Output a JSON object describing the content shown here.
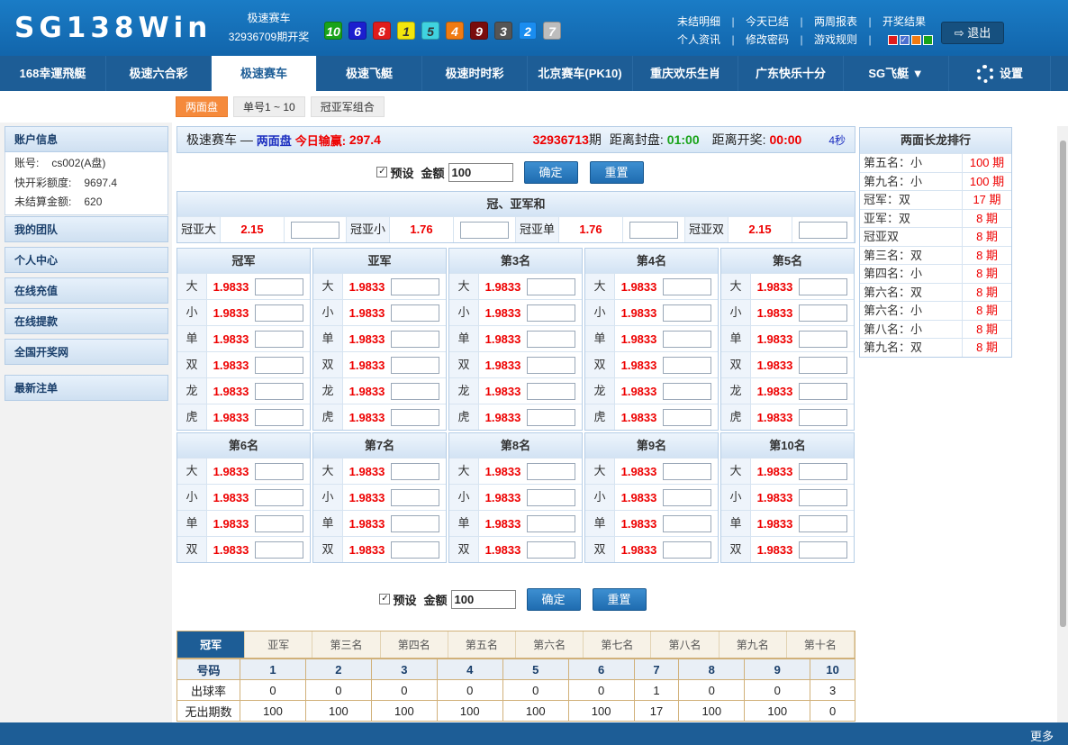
{
  "brand": {
    "logo": "SG138Win",
    "game": "极速赛车",
    "period": "32936709期开奖"
  },
  "balls": [
    {
      "n": "10",
      "c": "#19a319"
    },
    {
      "n": "6",
      "c": "#1b1fcf"
    },
    {
      "n": "8",
      "c": "#e01c1c"
    },
    {
      "n": "1",
      "c": "#f2e60d"
    },
    {
      "n": "5",
      "c": "#3fd3e0"
    },
    {
      "n": "4",
      "c": "#f07b12"
    },
    {
      "n": "9",
      "c": "#7a0c0c"
    },
    {
      "n": "3",
      "c": "#555555"
    },
    {
      "n": "2",
      "c": "#1a8df0"
    },
    {
      "n": "7",
      "c": "#bdbdbd"
    }
  ],
  "links": {
    "r1": [
      "未结明细",
      "今天已结",
      "两周报表",
      "开奖结果"
    ],
    "r2": [
      "个人资讯",
      "修改密码",
      "游戏规则"
    ]
  },
  "skins": [
    "#e01c1c",
    "#4a6fd0",
    "#f07b12",
    "#19a319"
  ],
  "logout": "退出",
  "nav": [
    {
      "l": "168幸運飛艇",
      "w": 118
    },
    {
      "l": "极速六合彩",
      "w": 117
    },
    {
      "l": "极速赛车",
      "w": 117,
      "a": true
    },
    {
      "l": "极速飞艇",
      "w": 117
    },
    {
      "l": "极速时时彩",
      "w": 117
    },
    {
      "l": "北京赛车(PK10)",
      "w": 117
    },
    {
      "l": "重庆欢乐生肖",
      "w": 117
    },
    {
      "l": "广东快乐十分",
      "w": 117
    },
    {
      "l": "SG飞艇 ▼",
      "w": 117
    },
    {
      "l": "设置",
      "w": 113,
      "g": true
    }
  ],
  "subtabs": [
    {
      "l": "两面盘",
      "a": true
    },
    {
      "l": "单号1 ~ 10"
    },
    {
      "l": "冠亚军组合"
    }
  ],
  "side": {
    "acct_title": "账户信息",
    "acct": [
      [
        "账号:",
        "cs002(A盘)"
      ],
      [
        "快开彩额度:",
        "9697.4"
      ],
      [
        "未结算金额:",
        "620"
      ]
    ],
    "menu": [
      "我的团队",
      "个人中心",
      "在线充值",
      "在线提款",
      "全国开奖网",
      "最新注单"
    ]
  },
  "title": {
    "game": "极速赛车",
    "dash": "—",
    "mode": "两面盘",
    "pnl_label": "今日输赢:",
    "pnl": "297.4",
    "period": "32936713",
    "period_unit": "期",
    "close_label": "距离封盘:",
    "close": "01:00",
    "draw_label": "距离开奖:",
    "draw": "00:00",
    "secs": "4秒"
  },
  "preset": {
    "label": "预设",
    "amount_label": "金额",
    "amount": "100",
    "ok": "确定",
    "reset": "重置"
  },
  "gyh": {
    "title": "冠、亚军和",
    "items": [
      {
        "l": "冠亚大",
        "o": "2.15"
      },
      {
        "l": "冠亚小",
        "o": "1.76"
      },
      {
        "l": "冠亚单",
        "o": "1.76"
      },
      {
        "l": "冠亚双",
        "o": "2.15"
      }
    ]
  },
  "groups1": [
    "冠军",
    "亚军",
    "第3名",
    "第4名",
    "第5名"
  ],
  "groups2": [
    "第6名",
    "第7名",
    "第8名",
    "第9名",
    "第10名"
  ],
  "opts1": [
    "大",
    "小",
    "单",
    "双",
    "龙",
    "虎"
  ],
  "opts2": [
    "大",
    "小",
    "单",
    "双"
  ],
  "odd": "1.9833",
  "dragon": {
    "title": "两面长龙排行",
    "rows": [
      [
        "第五名：小",
        "100 期"
      ],
      [
        "第九名：小",
        "100 期"
      ],
      [
        "冠军：双",
        "17 期"
      ],
      [
        "亚军：双",
        "8 期"
      ],
      [
        "冠亚双",
        "8 期"
      ],
      [
        "第三名：双",
        "8 期"
      ],
      [
        "第四名：小",
        "8 期"
      ],
      [
        "第六名：双",
        "8 期"
      ],
      [
        "第六名：小",
        "8 期"
      ],
      [
        "第八名：小",
        "8 期"
      ],
      [
        "第九名：双",
        "8 期"
      ]
    ]
  },
  "stats": {
    "tabs": [
      "冠军",
      "亚军",
      "第三名",
      "第四名",
      "第五名",
      "第六名",
      "第七名",
      "第八名",
      "第九名",
      "第十名"
    ],
    "h": "号码",
    "nums": [
      "1",
      "2",
      "3",
      "4",
      "5",
      "6",
      "7",
      "8",
      "9",
      "10"
    ],
    "r1": "出球率",
    "rate": [
      "0",
      "0",
      "0",
      "0",
      "0",
      "0",
      "1",
      "0",
      "0",
      "3"
    ],
    "r2": "无出期数",
    "miss": [
      "100",
      "100",
      "100",
      "100",
      "100",
      "100",
      "17",
      "100",
      "100",
      "0"
    ]
  },
  "footer_more": "更多"
}
